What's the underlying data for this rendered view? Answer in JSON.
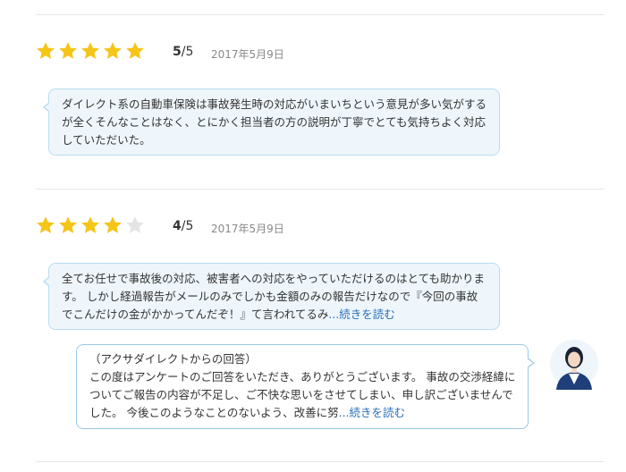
{
  "reviews": [
    {
      "rating": 5,
      "score_value": "5",
      "score_suffix": "/5",
      "date": "2017年5月9日",
      "text": "ダイレクト系の自動車保険は事故発生時の対応がいまいちという意見が多い気がするが全くそんなことはなく、とにかく担当者の方の説明が丁寧でとても気持ちよく対応していただいた。"
    },
    {
      "rating": 4,
      "score_value": "4",
      "score_suffix": "/5",
      "date": "2017年5月9日",
      "text": "全てお任せで事故後の対応、被害者への対応をやっていただけるのはとても助かります。 しかし経過報告がメールのみでしかも金額のみの報告だけなので『今回の事故でこんだけの金がかかってんだぞ！』て言われてるみ",
      "more_label": "...続きを読む",
      "reply": {
        "heading": "（アクサダイレクトからの回答）",
        "text": "この度はアンケートのご回答をいただき、ありがとうございます。 事故の交渉経緯についてご報告の内容が不足し、ご不快な思いをさせてしまい、申し訳ございませんでした。 今後このようなことのないよう、改善に努",
        "more_label": "...続きを読む"
      }
    }
  ],
  "colors": {
    "star_filled": "#f5c518",
    "star_empty": "#e4e4e4",
    "bubble_bg": "#eef6fc",
    "bubble_border": "#b8dcf2",
    "reply_border": "#9cc9e6",
    "link": "#2a6fb8",
    "avatar_suit": "#1f3f7a"
  },
  "icons": {
    "star": "star-icon",
    "avatar": "agent-avatar-icon"
  }
}
